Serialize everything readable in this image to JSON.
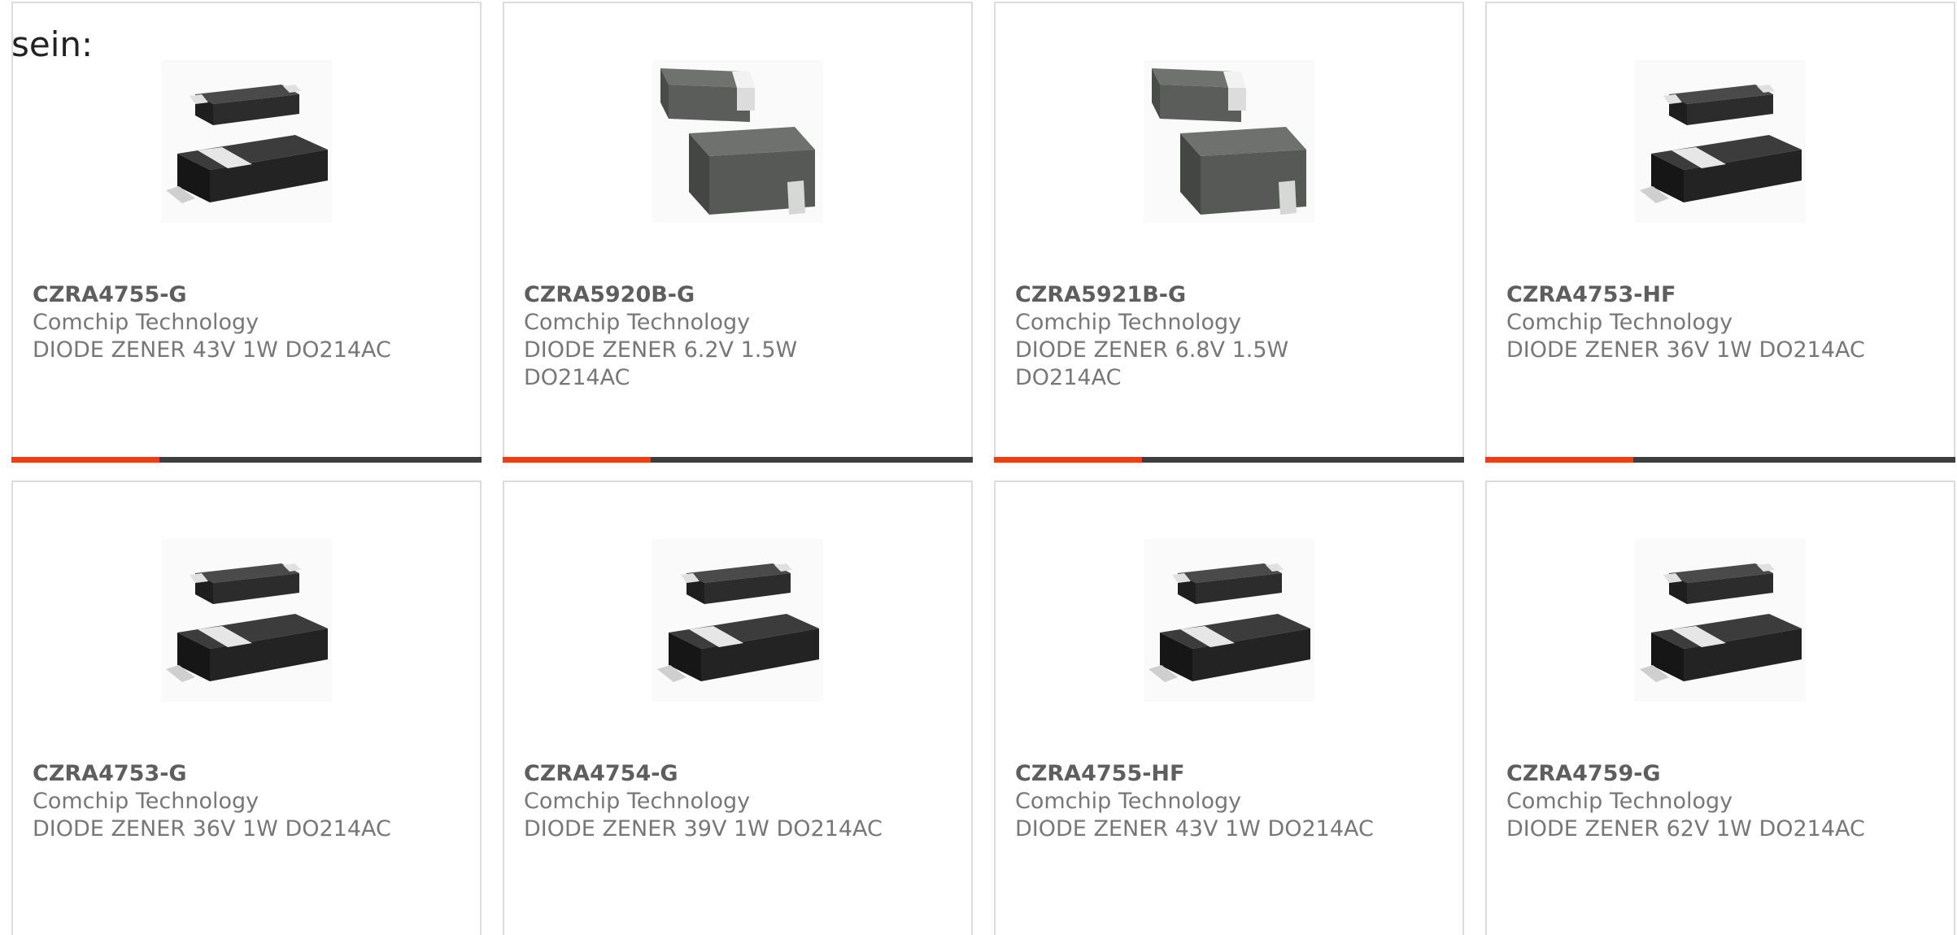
{
  "intro_text": "sein:",
  "accent_color": "#e8401b",
  "products": [
    {
      "part": "CZRA4755-G",
      "maker": "Comchip Technology",
      "desc": "DIODE ZENER 43V 1W DO214AC",
      "image": "sma-diode-package"
    },
    {
      "part": "CZRA5920B-G",
      "maker": "Comchip Technology",
      "desc": "DIODE ZENER 6.2V 1.5W DO214AC",
      "image": "molded-diode-package"
    },
    {
      "part": "CZRA5921B-G",
      "maker": "Comchip Technology",
      "desc": "DIODE ZENER 6.8V 1.5W DO214AC",
      "image": "molded-diode-package"
    },
    {
      "part": "CZRA4753-HF",
      "maker": "Comchip Technology",
      "desc": "DIODE ZENER 36V 1W DO214AC",
      "image": "sma-diode-package"
    },
    {
      "part": "CZRA4753-G",
      "maker": "Comchip Technology",
      "desc": "DIODE ZENER 36V 1W DO214AC",
      "image": "sma-diode-package"
    },
    {
      "part": "CZRA4754-G",
      "maker": "Comchip Technology",
      "desc": "DIODE ZENER 39V 1W DO214AC",
      "image": "sma-diode-package"
    },
    {
      "part": "CZRA4755-HF",
      "maker": "Comchip Technology",
      "desc": "DIODE ZENER 43V 1W DO214AC",
      "image": "sma-diode-package"
    },
    {
      "part": "CZRA4759-G",
      "maker": "Comchip Technology",
      "desc": "DIODE ZENER 62V 1W DO214AC",
      "image": "sma-diode-package"
    }
  ]
}
